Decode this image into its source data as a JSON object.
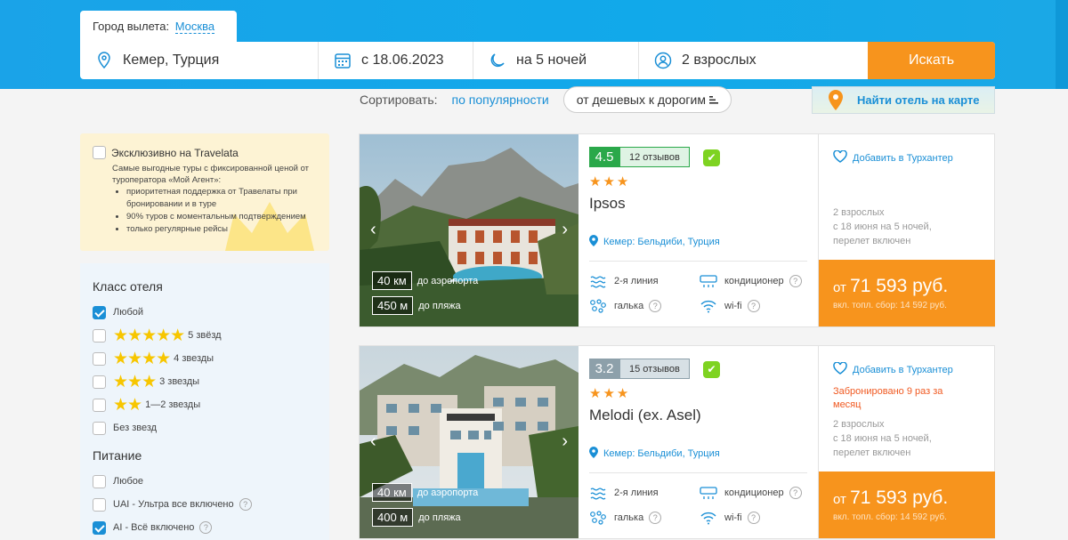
{
  "header": {
    "departure_label": "Город вылета:",
    "departure_city": "Москва",
    "destination": "Кемер, Турция",
    "date": "с 18.06.2023",
    "nights": "на 5 ночей",
    "guests": "2 взрослых",
    "search_button": "Искать"
  },
  "sort": {
    "label": "Сортировать:",
    "popularity": "по популярности",
    "cheap_first": "от дешевых к дорогим"
  },
  "map_button": "Найти отель на карте",
  "exclusive": {
    "title": "Эксклюзивно на Travelata",
    "desc": "Самые выгодные туры с фиксированной ценой от туроператора «Мой Агент»:",
    "bullets": [
      "приоритетная поддержка от Травелаты при бронировании и в туре",
      "90% туров с моментальным подтверждением",
      "только регулярные рейсы"
    ]
  },
  "filters": {
    "hotel_class_title": "Класс отеля",
    "hotel_class": [
      {
        "label": "Любой",
        "checked": true,
        "stars": ""
      },
      {
        "label": "5 звёзд",
        "checked": false,
        "stars": "★★★★★"
      },
      {
        "label": "4 звезды",
        "checked": false,
        "stars": "★★★★"
      },
      {
        "label": "3 звезды",
        "checked": false,
        "stars": "★★★"
      },
      {
        "label": "1—2 звезды",
        "checked": false,
        "stars": "★★"
      },
      {
        "label": "Без звезд",
        "checked": false,
        "stars": ""
      }
    ],
    "food_title": "Питание",
    "food": [
      {
        "label": "Любое",
        "checked": false
      },
      {
        "label": "UAI - Ультра все включено",
        "checked": false
      },
      {
        "label": "AI - Всё включено",
        "checked": true
      }
    ]
  },
  "hotels": [
    {
      "rating": "4.5",
      "reviews": "12 отзывов",
      "stars": "★★★",
      "name": "Ipsos",
      "location": "Кемер: Бельдиби, Турция",
      "airport_km": "40 км",
      "airport_label": "до аэропорта",
      "beach_m": "450 м",
      "beach_label": "до пляжа",
      "line": "2-я линия",
      "ac": "кондиционер",
      "beach_type": "галька",
      "wifi": "wi-fi",
      "favorite": "Добавить в Турхантер",
      "booked": "",
      "guests": "2 взрослых",
      "dates": "с 18 июня на 5 ночей,",
      "flight": "перелет включен",
      "price_prefix": "от",
      "price": "71 593 руб.",
      "fee": "вкл. топл. сбор: 14 592 руб."
    },
    {
      "rating": "3.2",
      "reviews": "15 отзывов",
      "stars": "★★★",
      "name": "Melodi (ex. Asel)",
      "location": "Кемер: Бельдиби, Турция",
      "airport_km": "40 км",
      "airport_label": "до аэропорта",
      "beach_m": "400 м",
      "beach_label": "до пляжа",
      "line": "2-я линия",
      "ac": "кондиционер",
      "beach_type": "галька",
      "wifi": "wi-fi",
      "favorite": "Добавить в Турхантер",
      "booked": "Забронировано 9 раз за месяц",
      "guests": "2 взрослых",
      "dates": "с 18 июня на 5 ночей,",
      "flight": "перелет включен",
      "price_prefix": "от",
      "price": "71 593 руб.",
      "fee": "вкл. топл. сбор: 14 592 руб."
    }
  ],
  "colors": {
    "header_blue": "#1aa3e8",
    "accent_orange": "#f7941d",
    "link_blue": "#1a8fd6",
    "rating_green": "#2aa84a"
  }
}
